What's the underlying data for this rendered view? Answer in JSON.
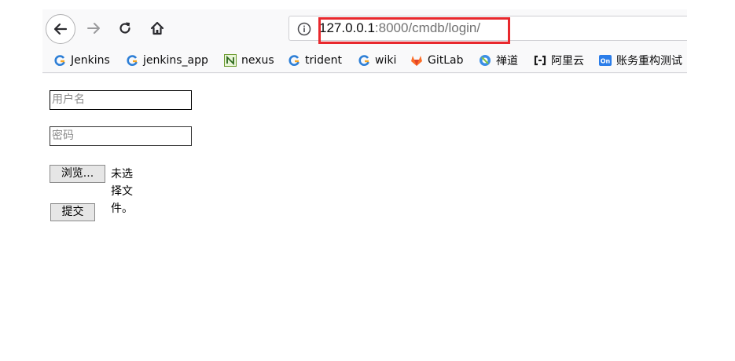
{
  "browser": {
    "url_host": "127.0.0.1",
    "url_rest": ":8000/cmdb/login/",
    "highlight_color": "#e8282d",
    "icons": [
      "back-arrow-icon",
      "forward-arrow-icon",
      "reload-icon",
      "home-icon",
      "info-icon"
    ],
    "bookmarks": [
      {
        "label": "Jenkins",
        "icon": "jenkins-icon"
      },
      {
        "label": "jenkins_app",
        "icon": "jenkins-icon"
      },
      {
        "label": "nexus",
        "icon": "nexus-icon"
      },
      {
        "label": "trident",
        "icon": "jenkins-icon"
      },
      {
        "label": "wiki",
        "icon": "jenkins-icon"
      },
      {
        "label": "GitLab",
        "icon": "gitlab-icon"
      },
      {
        "label": "禅道",
        "icon": "zentao-icon"
      },
      {
        "label": "阿里云",
        "icon": "aliyun-icon"
      },
      {
        "label": "账务重构测试",
        "icon": "on-icon"
      }
    ]
  },
  "form": {
    "username_placeholder": "用户名",
    "password_placeholder": "密码",
    "browse_label": "浏览...",
    "no_file_text": "未选择文件。",
    "submit_label": "提交"
  }
}
